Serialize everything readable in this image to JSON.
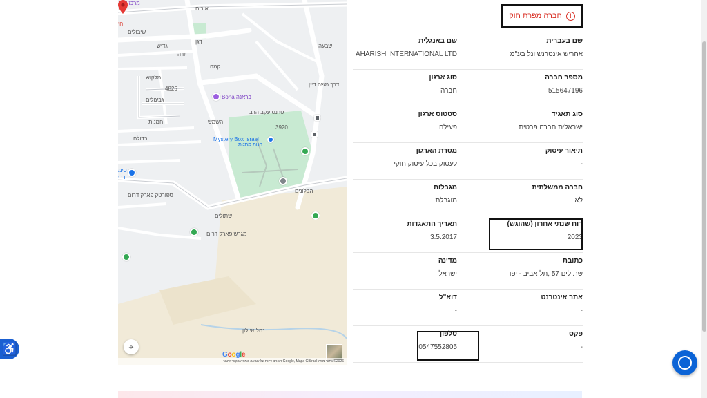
{
  "map": {
    "streets": [
      "אורים",
      "שיבולים",
      "גדיש",
      "יורה",
      "קמה",
      "מלקוש",
      "4825",
      "גבעולים",
      "דגן",
      "חמנית",
      "בדולח",
      "דרך משה דיין",
      "טרנס עקב הרב",
      "3920",
      "הבלונים",
      "שתולים",
      "ספורטק פארק דרום",
      "מגרש פארק דרום",
      "נחל איילון",
      "השמש",
      "שבעה"
    ],
    "pois": {
      "bona": "Bona בראנה",
      "mystery_box": "Mystery Box Israel",
      "mystery_box_sub": "חנות מתנות",
      "top_cut": "מרכז עמ׳",
      "left_cut1": "סימ",
      "left_cut2": "דרי",
      "left_cut3": "הי"
    },
    "google": "Google",
    "footer": "2026© נתוני מפה Google, Mapa GISrael  תנאים  דיווח על שגיאה במפה  מקשי קיצור"
  },
  "status_badge": "חברה מפרת חוק",
  "rows": [
    {
      "right": {
        "label": "שם בעברית",
        "value": "אהריש אינטרנשיונל בע\"מ"
      },
      "left": {
        "label": "שם באנגלית",
        "value": "AHARISH INTERNATIONAL LTD"
      }
    },
    {
      "right": {
        "label": "מספר חברה",
        "value": "515647196"
      },
      "left": {
        "label": "סוג ארגון",
        "value": "חברה"
      }
    },
    {
      "right": {
        "label": "סוג תאגיד",
        "value": "ישראלית חברה פרטית"
      },
      "left": {
        "label": "סטטוס ארגון",
        "value": "פעילה"
      }
    },
    {
      "right": {
        "label": "תיאור עיסוק",
        "value": "-"
      },
      "left": {
        "label": "מטרת הארגון",
        "value": "לעסוק בכל עיסוק חוקי"
      }
    },
    {
      "right": {
        "label": "חברה ממשלתית",
        "value": "לא"
      },
      "left": {
        "label": "מגבלות",
        "value": "מוגבלת"
      }
    },
    {
      "right": {
        "label": "דוח שנתי אחרון (שהוגש)",
        "value": "2023"
      },
      "left": {
        "label": "תאריך התאגדות",
        "value": "3.5.2017"
      }
    },
    {
      "right": {
        "label": "כתובת",
        "value": "שתולים 57 ,תל אביב - יפו"
      },
      "left": {
        "label": "מדינה",
        "value": "ישראל"
      }
    },
    {
      "right": {
        "label": "אתר אינטרנט",
        "value": "-"
      },
      "left": {
        "label": "דוא\"ל",
        "value": "-"
      }
    },
    {
      "right": {
        "label": "פקס",
        "value": "-"
      },
      "left": {
        "label": "טלפון",
        "value": "0547552805"
      }
    }
  ],
  "colors": {
    "accent_red": "#d93025",
    "map_green": "#c8ead2",
    "chat_blue": "#0b63d6"
  },
  "icons": [
    "alert-circle-icon",
    "map-pin-icon",
    "accessibility-icon",
    "chat-icon",
    "recenter-icon"
  ]
}
